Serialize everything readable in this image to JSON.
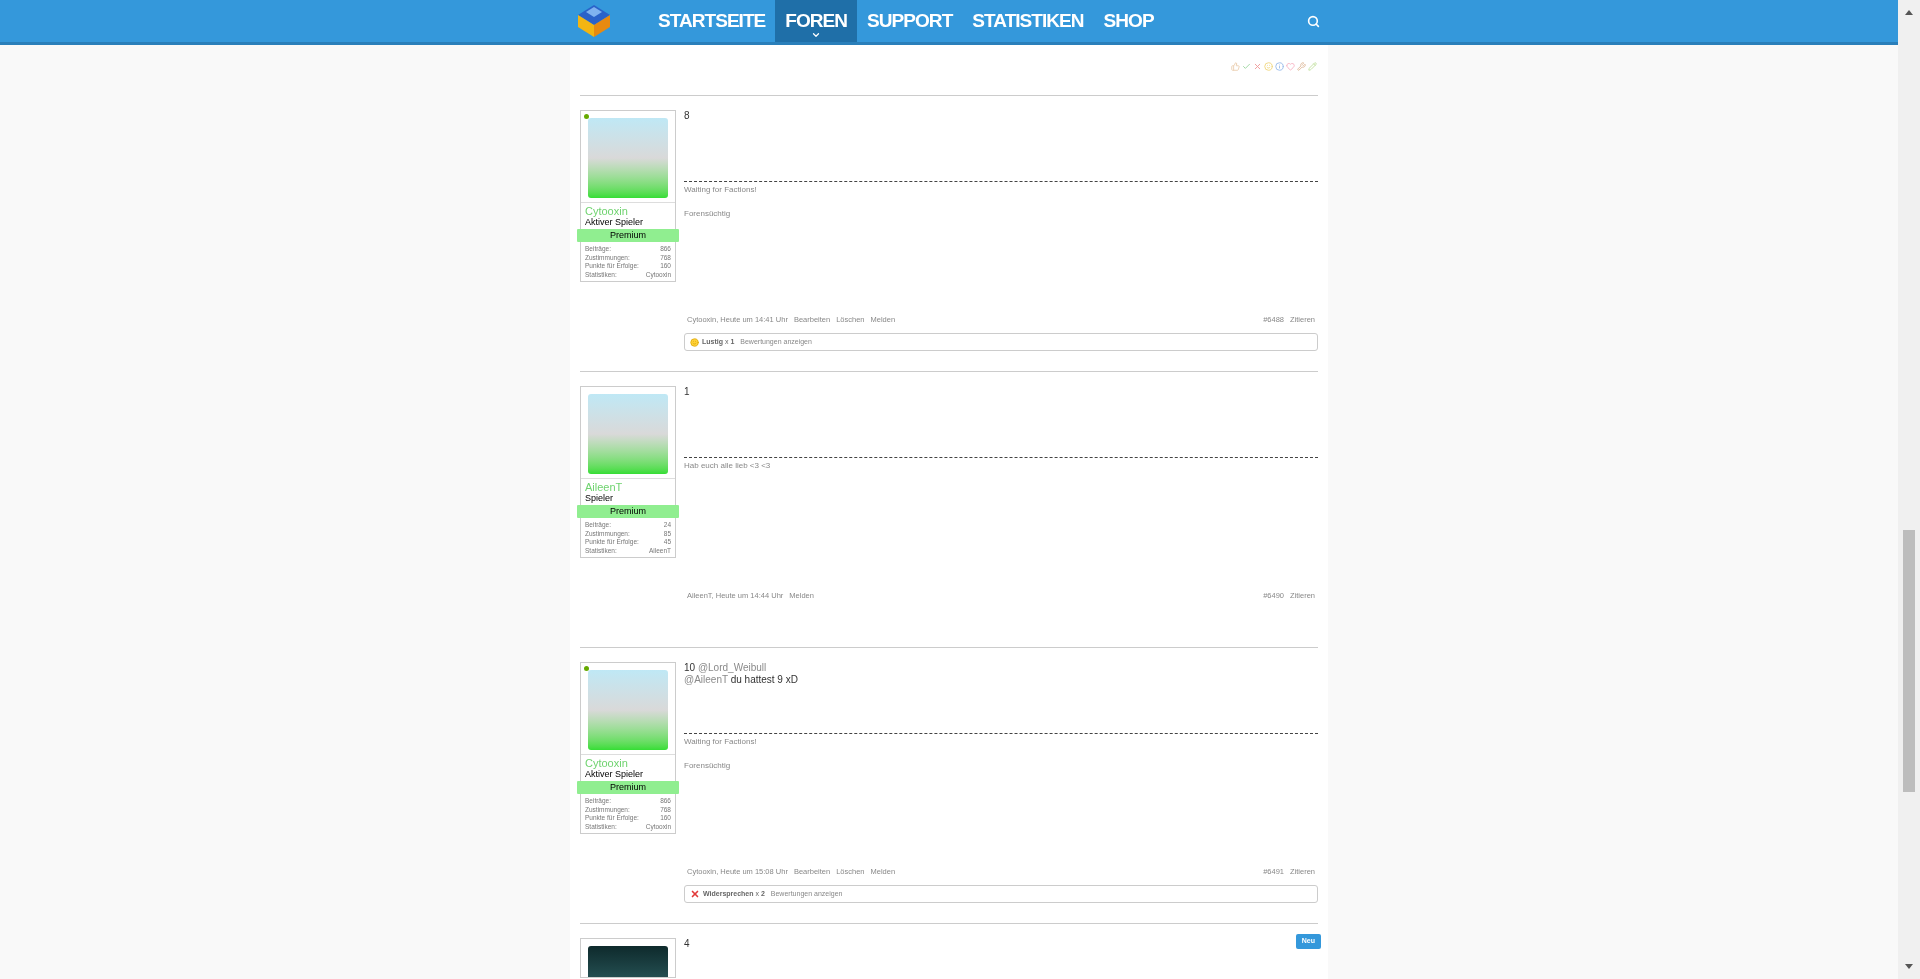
{
  "nav": {
    "items": [
      {
        "label": "STARTSEITE",
        "selected": false
      },
      {
        "label": "FOREN",
        "selected": true
      },
      {
        "label": "SUPPORT",
        "selected": false
      },
      {
        "label": "STATISTIKEN",
        "selected": false
      },
      {
        "label": "SHOP",
        "selected": false
      }
    ]
  },
  "posts": [
    {
      "author": {
        "name": "Cytooxin",
        "title": "Aktiver Spieler",
        "online": true,
        "badge": "Premium",
        "stats": [
          {
            "label": "Beiträge:",
            "value": "866"
          },
          {
            "label": "Zustimmungen:",
            "value": "768"
          },
          {
            "label": "Punkte für Erfolge:",
            "value": "160"
          },
          {
            "label": "Statistiken:",
            "value": "Cytooxin"
          }
        ]
      },
      "message": [
        [
          {
            "kind": "text",
            "text": "8"
          }
        ]
      ],
      "signature": [
        "Waiting for Factions!",
        "Forensüchtig"
      ],
      "footer": {
        "byline": "Cytooxin, Heute um 14:41 Uhr",
        "actions": [
          "Bearbeiten",
          "Löschen",
          "Melden"
        ],
        "number": "#6488",
        "quote": "Zitieren"
      },
      "ratings": {
        "kind": "funny",
        "label": "**Lustig** x **1**",
        "show": "Bewertungen anzeigen"
      }
    },
    {
      "author": {
        "name": "AileenT",
        "title": "Spieler",
        "online": false,
        "badge": "Premium",
        "stats": [
          {
            "label": "Beiträge:",
            "value": "24"
          },
          {
            "label": "Zustimmungen:",
            "value": "85"
          },
          {
            "label": "Punkte für Erfolge:",
            "value": "45"
          },
          {
            "label": "Statistiken:",
            "value": "AileenT"
          }
        ]
      },
      "message": [
        [
          {
            "kind": "text",
            "text": "1"
          }
        ]
      ],
      "signature": [
        "Hab euch alle lieb <3 <3"
      ],
      "footer": {
        "byline": "AileenT, Heute um 14:44 Uhr",
        "actions": [
          "Melden"
        ],
        "number": "#6490",
        "quote": "Zitieren"
      }
    },
    {
      "author": {
        "name": "Cytooxin",
        "title": "Aktiver Spieler",
        "online": true,
        "badge": "Premium",
        "stats": [
          {
            "label": "Beiträge:",
            "value": "866"
          },
          {
            "label": "Zustimmungen:",
            "value": "768"
          },
          {
            "label": "Punkte für Erfolge:",
            "value": "160"
          },
          {
            "label": "Statistiken:",
            "value": "Cytooxin"
          }
        ]
      },
      "message": [
        [
          {
            "kind": "text",
            "text": "10 "
          },
          {
            "kind": "mention",
            "text": "@Lord_Weibull"
          }
        ],
        [
          {
            "kind": "mention",
            "text": "@AileenT"
          },
          {
            "kind": "text",
            "text": " du hattest 9 xD"
          }
        ]
      ],
      "signature": [
        "Waiting for Factions!",
        "Forensüchtig"
      ],
      "footer": {
        "byline": "Cytooxin, Heute um 15:08 Uhr",
        "actions": [
          "Bearbeiten",
          "Löschen",
          "Melden"
        ],
        "number": "#6491",
        "quote": "Zitieren"
      },
      "ratings": {
        "kind": "disagree",
        "label": "**Widersprechen** x **2**",
        "show": "Bewertungen anzeigen"
      }
    },
    {
      "author": {
        "online": false
      },
      "message": [
        [
          {
            "kind": "text",
            "text": "4"
          }
        ]
      ],
      "new_badge": "Neu"
    }
  ]
}
